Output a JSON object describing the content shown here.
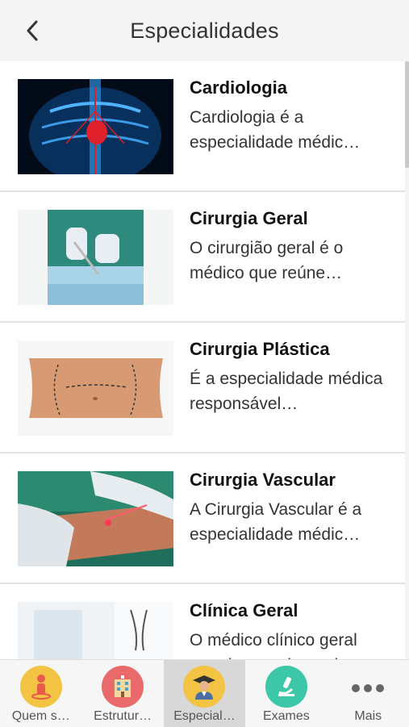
{
  "header": {
    "title": "Especialidades"
  },
  "items": [
    {
      "title": "Cardiologia",
      "description": "Cardiologia é a especialidade médic…"
    },
    {
      "title": "Cirurgia Geral",
      "description": "O cirurgião geral é o médico que reúne…"
    },
    {
      "title": "Cirurgia Plástica",
      "description": "É a especialidade médica responsável…"
    },
    {
      "title": "Cirurgia Vascular",
      "description": "A Cirurgia Vascular é a especialidade médic…"
    },
    {
      "title": "Clínica Geral",
      "description": "O médico clínico geral atende o paciente d…"
    }
  ],
  "tabs": [
    {
      "label": "Quem s…",
      "icon": "person-pin-icon",
      "color": "#f3c443"
    },
    {
      "label": "Estrutur…",
      "icon": "hospital-building-icon",
      "color": "#e86a6a"
    },
    {
      "label": "Especial…",
      "icon": "doctor-icon",
      "color": "#f3c443"
    },
    {
      "label": "Exames",
      "icon": "microscope-icon",
      "color": "#3cc8a8"
    },
    {
      "label": "Mais",
      "icon": "more-dots-icon",
      "color": "#666666"
    }
  ]
}
